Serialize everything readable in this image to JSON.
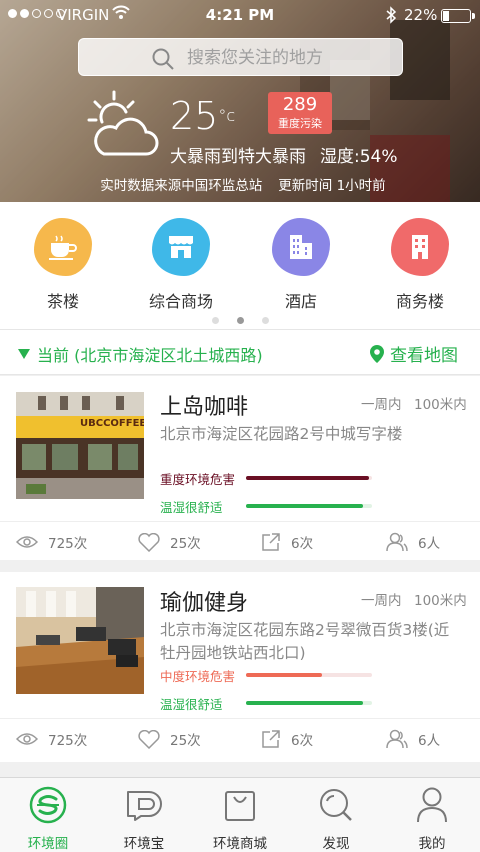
{
  "status": {
    "carrier": "VIRGIN",
    "time": "4:21 PM",
    "battery": "22%",
    "battery_level": 0.22
  },
  "search": {
    "placeholder": "搜索您关注的地方"
  },
  "weather": {
    "temperature": "25",
    "unit": "°c",
    "aqi_value": "289",
    "aqi_label": "重度污染",
    "description": "大暴雨到特大暴雨",
    "humidity": "湿度:54%",
    "source": "实时数据来源中国环监总站",
    "updated": "更新时间  1小时前"
  },
  "categories": [
    {
      "label": "茶楼",
      "icon": "teacup-icon",
      "color": "#f6b84c"
    },
    {
      "label": "综合商场",
      "icon": "storefront-icon",
      "color": "#3fb8e8"
    },
    {
      "label": "酒店",
      "icon": "hotel-building-icon",
      "color": "#8a86e6"
    },
    {
      "label": "商务楼",
      "icon": "office-building-icon",
      "color": "#f06a6a"
    }
  ],
  "pager": {
    "count": 3,
    "active": 1
  },
  "location": {
    "text": "当前  (北京市海淀区北土城西路)",
    "map_link": "查看地图"
  },
  "places": [
    {
      "title": "上岛咖啡",
      "frequency": "一周内",
      "distance": "100米内",
      "address": "北京市海淀区花园路2号中城写字楼",
      "env_label": "重度环境危害",
      "env_level": 0.98,
      "env_color": "#6a0f24",
      "comfort_label": "温湿很舒适",
      "comfort_level": 0.93,
      "views": "725次",
      "likes": "25次",
      "shares": "6次",
      "people": "6人",
      "sign_text": "UBCCOFFEE"
    },
    {
      "title": "瑜伽健身",
      "frequency": "一周内",
      "distance": "100米内",
      "address": "北京市海淀区花园东路2号翠微百货3楼(近牡丹园地铁站西北口)",
      "env_label": "中度环境危害",
      "env_level": 0.6,
      "env_color": "#ee6a55",
      "comfort_label": "温湿很舒适",
      "comfort_level": 0.93,
      "views": "725次",
      "likes": "25次",
      "shares": "6次",
      "people": "6人"
    }
  ],
  "tabs": [
    {
      "label": "环境圈",
      "icon": "env-circle-icon",
      "active": true
    },
    {
      "label": "环境宝",
      "icon": "env-treasure-icon",
      "active": false
    },
    {
      "label": "环境商城",
      "icon": "shopping-bag-icon",
      "active": false
    },
    {
      "label": "发现",
      "icon": "discover-search-icon",
      "active": false
    },
    {
      "label": "我的",
      "icon": "profile-icon",
      "active": false
    }
  ],
  "colors": {
    "accent": "#27b14e",
    "aqi_badge": "#e8625a"
  }
}
